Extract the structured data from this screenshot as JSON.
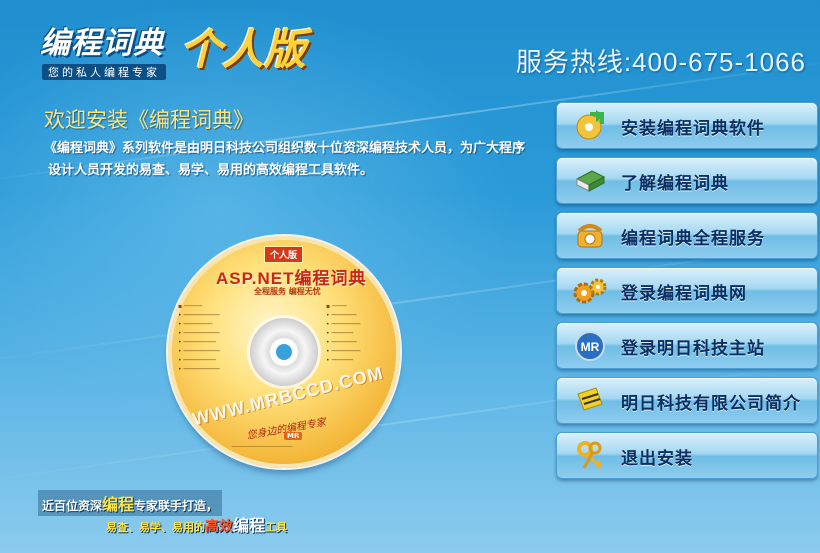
{
  "header": {
    "logo_title": "编程词典",
    "logo_edition": "个人版",
    "logo_subtitle": "您的私人编程专家",
    "hotline": "服务热线:400-675-1066"
  },
  "welcome": {
    "title": "欢迎安装《编程词典》",
    "intro_line1": "《编程词典》系列软件是由明日科技公司组织数十位资深编程技术人员，为广大程序",
    "intro_line2": "设计人员开发的易查、易学、易用的高效编程工具软件。"
  },
  "cd": {
    "badge": "个人版",
    "title": "ASP.NET编程词典",
    "slogan": "全程服务 编程无忧",
    "url": "WWW.MRBCCD.COM",
    "signature": "您身边的编程专家"
  },
  "slogan": {
    "line1_a": "近百位资深",
    "line1_b": "编程",
    "line1_c": "专家联手打造，",
    "line2_a": "易查、易学、易用的",
    "line2_b": "高效",
    "line2_c": "编程",
    "line2_d": "工具"
  },
  "menu": {
    "items": [
      {
        "label": "安装编程词典软件",
        "icon": "install-cd-icon"
      },
      {
        "label": "了解编程词典",
        "icon": "book-icon"
      },
      {
        "label": "编程词典全程服务",
        "icon": "telephone-icon"
      },
      {
        "label": "登录编程词典网",
        "icon": "gears-icon"
      },
      {
        "label": "登录明日科技主站",
        "icon": "mr-logo-icon"
      },
      {
        "label": "明日科技有限公司简介",
        "icon": "company-card-icon"
      },
      {
        "label": "退出安装",
        "icon": "keys-icon"
      }
    ]
  },
  "colors": {
    "background_top": "#1f8fcf",
    "background_bottom": "#8ccbee",
    "title_yellow": "#ffe57a",
    "menu_text": "#0b2f62"
  }
}
